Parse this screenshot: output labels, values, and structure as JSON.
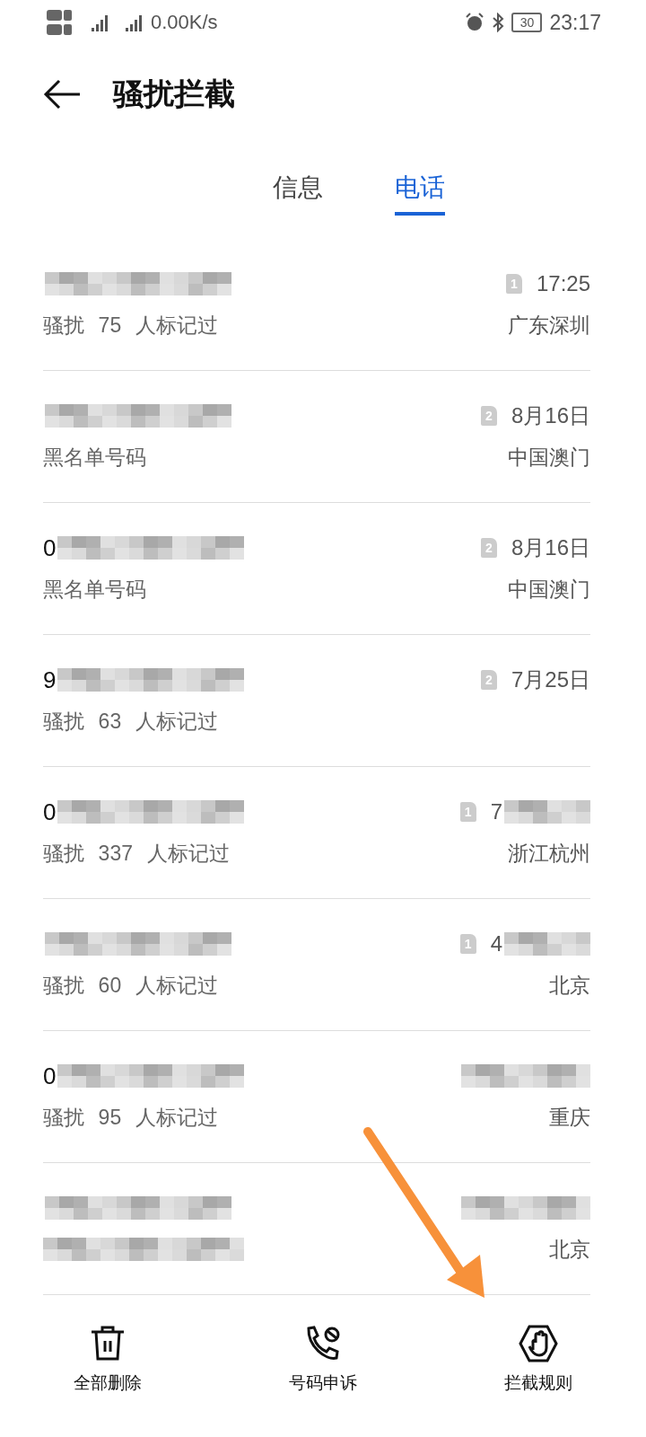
{
  "status_bar": {
    "network_speed": "0.00K/s",
    "battery": "30",
    "time": "23:17"
  },
  "header": {
    "title": "骚扰拦截"
  },
  "tabs": [
    {
      "label": "信息",
      "selected": false
    },
    {
      "label": "电话",
      "selected": true
    }
  ],
  "calls": [
    {
      "sim": "1",
      "time": "17:25",
      "tag": "骚扰 75 人标记过",
      "location": "广东深圳"
    },
    {
      "sim": "2",
      "time": "8月16日",
      "tag": "黑名单号码",
      "location": "中国澳门"
    },
    {
      "number": "0",
      "sim": "2",
      "time": "8月16日",
      "tag": "黑名单号码",
      "location": "中国澳门"
    },
    {
      "number": "9",
      "sim": "2",
      "time": "7月25日",
      "tag": "骚扰 63 人标记过"
    },
    {
      "number": "0",
      "sim": "1",
      "time": "7",
      "time_masked": true,
      "tag": "骚扰 337 人标记过",
      "location": "浙江杭州"
    },
    {
      "sim": "1",
      "time": "4",
      "time_masked": true,
      "tag": "骚扰 60 人标记过",
      "location": "北京"
    },
    {
      "number": "0",
      "time_masked": true,
      "tag": "骚扰 95 人标记过",
      "location": "重庆"
    },
    {
      "time_masked": true,
      "tag_masked": true,
      "location": "北京"
    }
  ],
  "actions": [
    {
      "kind": "delete",
      "label": "全部删除"
    },
    {
      "kind": "appeal",
      "label": "号码申诉"
    },
    {
      "kind": "rules",
      "label": "拦截规则"
    }
  ]
}
